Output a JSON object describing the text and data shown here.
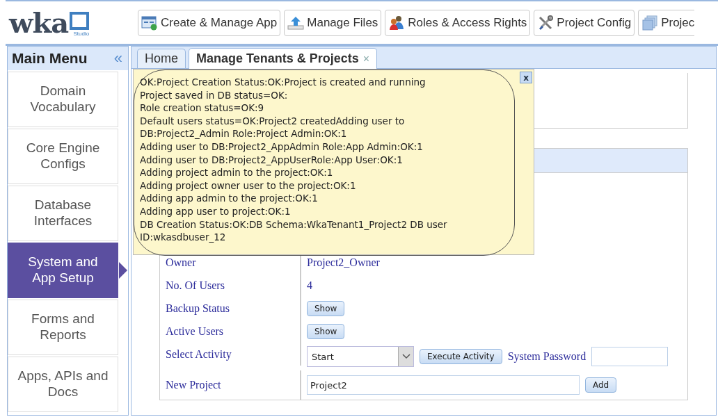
{
  "logo": {
    "text": "wka",
    "subtext": "Studio"
  },
  "toolbar": [
    {
      "label": "Create & Manage App"
    },
    {
      "label": "Manage Files"
    },
    {
      "label": "Roles & Access Rights"
    },
    {
      "label": "Project Config"
    },
    {
      "label": "Projec"
    }
  ],
  "sidebar": {
    "title": "Main Menu",
    "collapse": "«",
    "items": [
      {
        "label": "Domain Vocabulary",
        "selected": false
      },
      {
        "label": "Core Engine Configs",
        "selected": false
      },
      {
        "label": "Database Interfaces",
        "selected": false
      },
      {
        "label": "System and App Setup",
        "selected": true
      },
      {
        "label": "Forms and Reports",
        "selected": false
      },
      {
        "label": "Apps, APIs and Docs",
        "selected": false
      }
    ]
  },
  "tabs": [
    {
      "label": "Home",
      "selected": false,
      "closable": false
    },
    {
      "label": "Manage Tenants & Projects",
      "selected": true,
      "closable": true,
      "close": "×"
    }
  ],
  "message": {
    "close": "x",
    "lines": [
      "OK:Project Creation Status:OK:Project is created and running",
      "Project saved in DB status=OK:",
      "Role creation status=OK:9",
      "Default users status=OK:Project2 createdAdding user to",
      "DB:Project2_Admin Role:Project Admin:OK:1",
      "Adding user to DB:Project2_AppAdmin Role:App Admin:OK:1",
      "Adding user to DB:Project2_AppUserRole:App User:OK:1",
      "Adding project admin to the project:OK:1",
      "Adding project owner user to the project:OK:1",
      "Adding app admin to the project:OK:1",
      "Adding app user to project:OK:1",
      "DB Creation Status:OK:DB Schema:WkaTenant1_Project2 DB user",
      "ID:wkasdbuser_12"
    ]
  },
  "details": [
    {
      "label": "Owner",
      "kind": "text",
      "value": "Project2_Owner"
    },
    {
      "label": "No. Of Users",
      "kind": "text",
      "value": "4"
    },
    {
      "label": "Backup Status",
      "kind": "button",
      "button": "Show"
    },
    {
      "label": "Active Users",
      "kind": "button",
      "button": "Show"
    },
    {
      "label": "Select Activity",
      "kind": "activity",
      "value": "Start",
      "button": "Execute Activity",
      "password_label": "System Password"
    },
    {
      "label": "New Project",
      "kind": "input",
      "value": "Project2",
      "button": "Add"
    }
  ]
}
